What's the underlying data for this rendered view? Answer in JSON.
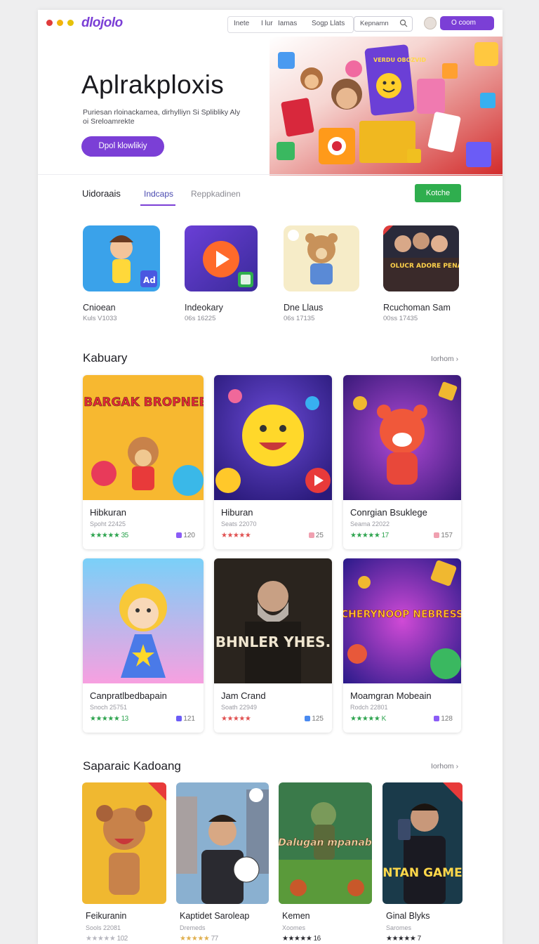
{
  "window": {
    "dot_colors": [
      "#e03b3b",
      "#f2b30c",
      "#e6c20a"
    ]
  },
  "brand": {
    "logo": "dlojolo",
    "accent": "#7b3fd6",
    "green": "#2fae4e"
  },
  "nav": {
    "items": [
      "Inete",
      "I lur",
      "Iamas",
      "Sogp Llats"
    ],
    "search_placeholder": "Kepnamn",
    "cta": "O coom"
  },
  "hero": {
    "title": "Aplrakploxis",
    "subtitle": "Puriesan rloinackamea, dirhylliyn Si Splibliky Aly oi Sreloamrekte",
    "button": "Dpol klowlikiy",
    "art_badge": "VERDU OBOZVID"
  },
  "tabs": {
    "items": [
      "Uidoraais",
      "Indcaps",
      "Reppkadinen"
    ],
    "active": 1,
    "action": "Kotche"
  },
  "featured": [
    {
      "name": "Cnioean",
      "meta": "Kuls V1033",
      "badge": "Ad"
    },
    {
      "name": "Indeokary",
      "meta": "06s 16225",
      "badge": ""
    },
    {
      "name": "Dne Llaus",
      "meta": "06s 17135",
      "badge": ""
    },
    {
      "name": "Rcuchoman Sam",
      "meta": "00ss 17435",
      "badge": "OLUCR ADORE PENACE GHOEARL"
    }
  ],
  "section1": {
    "title": "Kabuary",
    "link": "Iorhom",
    "cards": [
      {
        "name": "Hibkuran",
        "meta": "Spoht 22425",
        "stars": "★★★★★",
        "rating": "35",
        "count": "120",
        "star_color": "#2ea44f",
        "count_color": "#8b5cf6",
        "art_text": "HIBARGAK BROPNEEN"
      },
      {
        "name": "Hiburan",
        "meta": "Seats 22070",
        "stars": "★★★★★",
        "rating": "",
        "count": "25",
        "star_color": "#e05050",
        "count_color": "#f0a0b0",
        "art_text": ""
      },
      {
        "name": "Conrgian Bsuklege",
        "meta": "Seama 22022",
        "stars": "★★★★★",
        "rating": "17",
        "count": "157",
        "star_color": "#2ea44f",
        "count_color": "#f0a0b0",
        "art_text": ""
      },
      {
        "name": "Canpratlbedbapain",
        "meta": "Snoch 25751",
        "stars": "★★★★★",
        "rating": "13",
        "count": "121",
        "star_color": "#2ea44f",
        "count_color": "#6b5cf6",
        "art_text": ""
      },
      {
        "name": "Jam Crand",
        "meta": "Soath 22949",
        "stars": "★★★★★",
        "rating": "",
        "count": "125",
        "star_color": "#e05050",
        "count_color": "#4a8af0",
        "art_text": "BHNLER YHES."
      },
      {
        "name": "Moamgran Mobeain",
        "meta": "Rodch 22801",
        "stars": "★★★★★",
        "rating": "K",
        "count": "128",
        "star_color": "#2ea44f",
        "count_color": "#8b5cf6",
        "art_text": "CHERYNOOP NEBRESS"
      }
    ]
  },
  "section2": {
    "title": "Saparaic Kadoang",
    "link": "Iorhom",
    "cards": [
      {
        "name": "Feikuranin",
        "meta": "Sools 22081",
        "stars": "★★★★★",
        "rating": "102",
        "art_text": ""
      },
      {
        "name": "Kaptidet Saroleap",
        "meta": "Dremeds",
        "stars": "★★★★★",
        "rating": "77",
        "art_text": ""
      },
      {
        "name": "Kemen",
        "meta": "Xoomes",
        "stars": "★★★★★",
        "rating": "16",
        "art_text": "Dalugan mpanab"
      },
      {
        "name": "Ginal Blyks",
        "meta": "Saromes",
        "stars": "★★★★★",
        "rating": "7",
        "art_text": "ENTAN GAMEE"
      }
    ]
  }
}
